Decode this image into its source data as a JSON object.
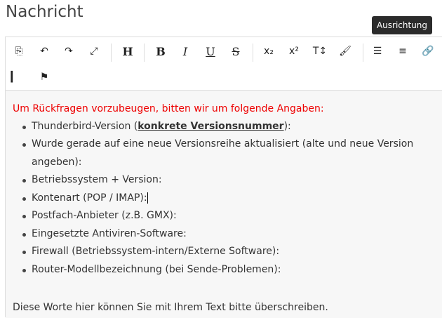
{
  "title": "Nachricht",
  "tooltip": "Ausrichtung",
  "toolbar": {
    "row1": [
      {
        "name": "source-code-icon",
        "glyph": "⎘"
      },
      {
        "name": "undo-icon",
        "glyph": "↶"
      },
      {
        "name": "redo-icon",
        "glyph": "↷"
      },
      {
        "name": "fullscreen-icon",
        "glyph": "⤢"
      },
      {
        "name": "heading-icon",
        "glyph": "H"
      },
      {
        "name": "bold-icon",
        "glyph": "B"
      },
      {
        "name": "italic-icon",
        "glyph": "I"
      },
      {
        "name": "underline-icon",
        "glyph": "U"
      },
      {
        "name": "strikethrough-icon",
        "glyph": "S"
      },
      {
        "name": "subscript-icon",
        "glyph": "x₂"
      },
      {
        "name": "superscript-icon",
        "glyph": "x²"
      },
      {
        "name": "font-size-icon",
        "glyph": "T↕"
      },
      {
        "name": "paint-brush-icon",
        "glyph": "🖌"
      },
      {
        "name": "list-icon",
        "glyph": "☰"
      },
      {
        "name": "align-icon",
        "glyph": "≡"
      },
      {
        "name": "link-icon",
        "glyph": "🔗"
      }
    ],
    "row2": [
      {
        "name": "text-cursor-icon",
        "glyph": "▎"
      },
      {
        "name": "flag-icon",
        "glyph": "⚑"
      }
    ]
  },
  "content": {
    "intro": "Um Rückfragen vorzubeugen, bitten wir um folgende Angaben:",
    "item0_pre": "Thunderbird-Version (",
    "item0_bold": "konkrete Versionsnummer",
    "item0_post": "):",
    "items": [
      "Wurde gerade auf eine neue Versionsreihe aktualisiert (alte und neue Version angeben):",
      "Betriebssystem + Version:",
      "Kontenart (POP / IMAP):",
      "Postfach-Anbieter (z.B. GMX):",
      "Eingesetzte Antiviren-Software:",
      "Firewall (Betriebssystem-intern/Externe Software):",
      "Router-Modellbezeichnung (bei Sende-Problemen):"
    ],
    "footer": "Diese Worte hier können Sie mit Ihrem Text bitte überschreiben."
  }
}
